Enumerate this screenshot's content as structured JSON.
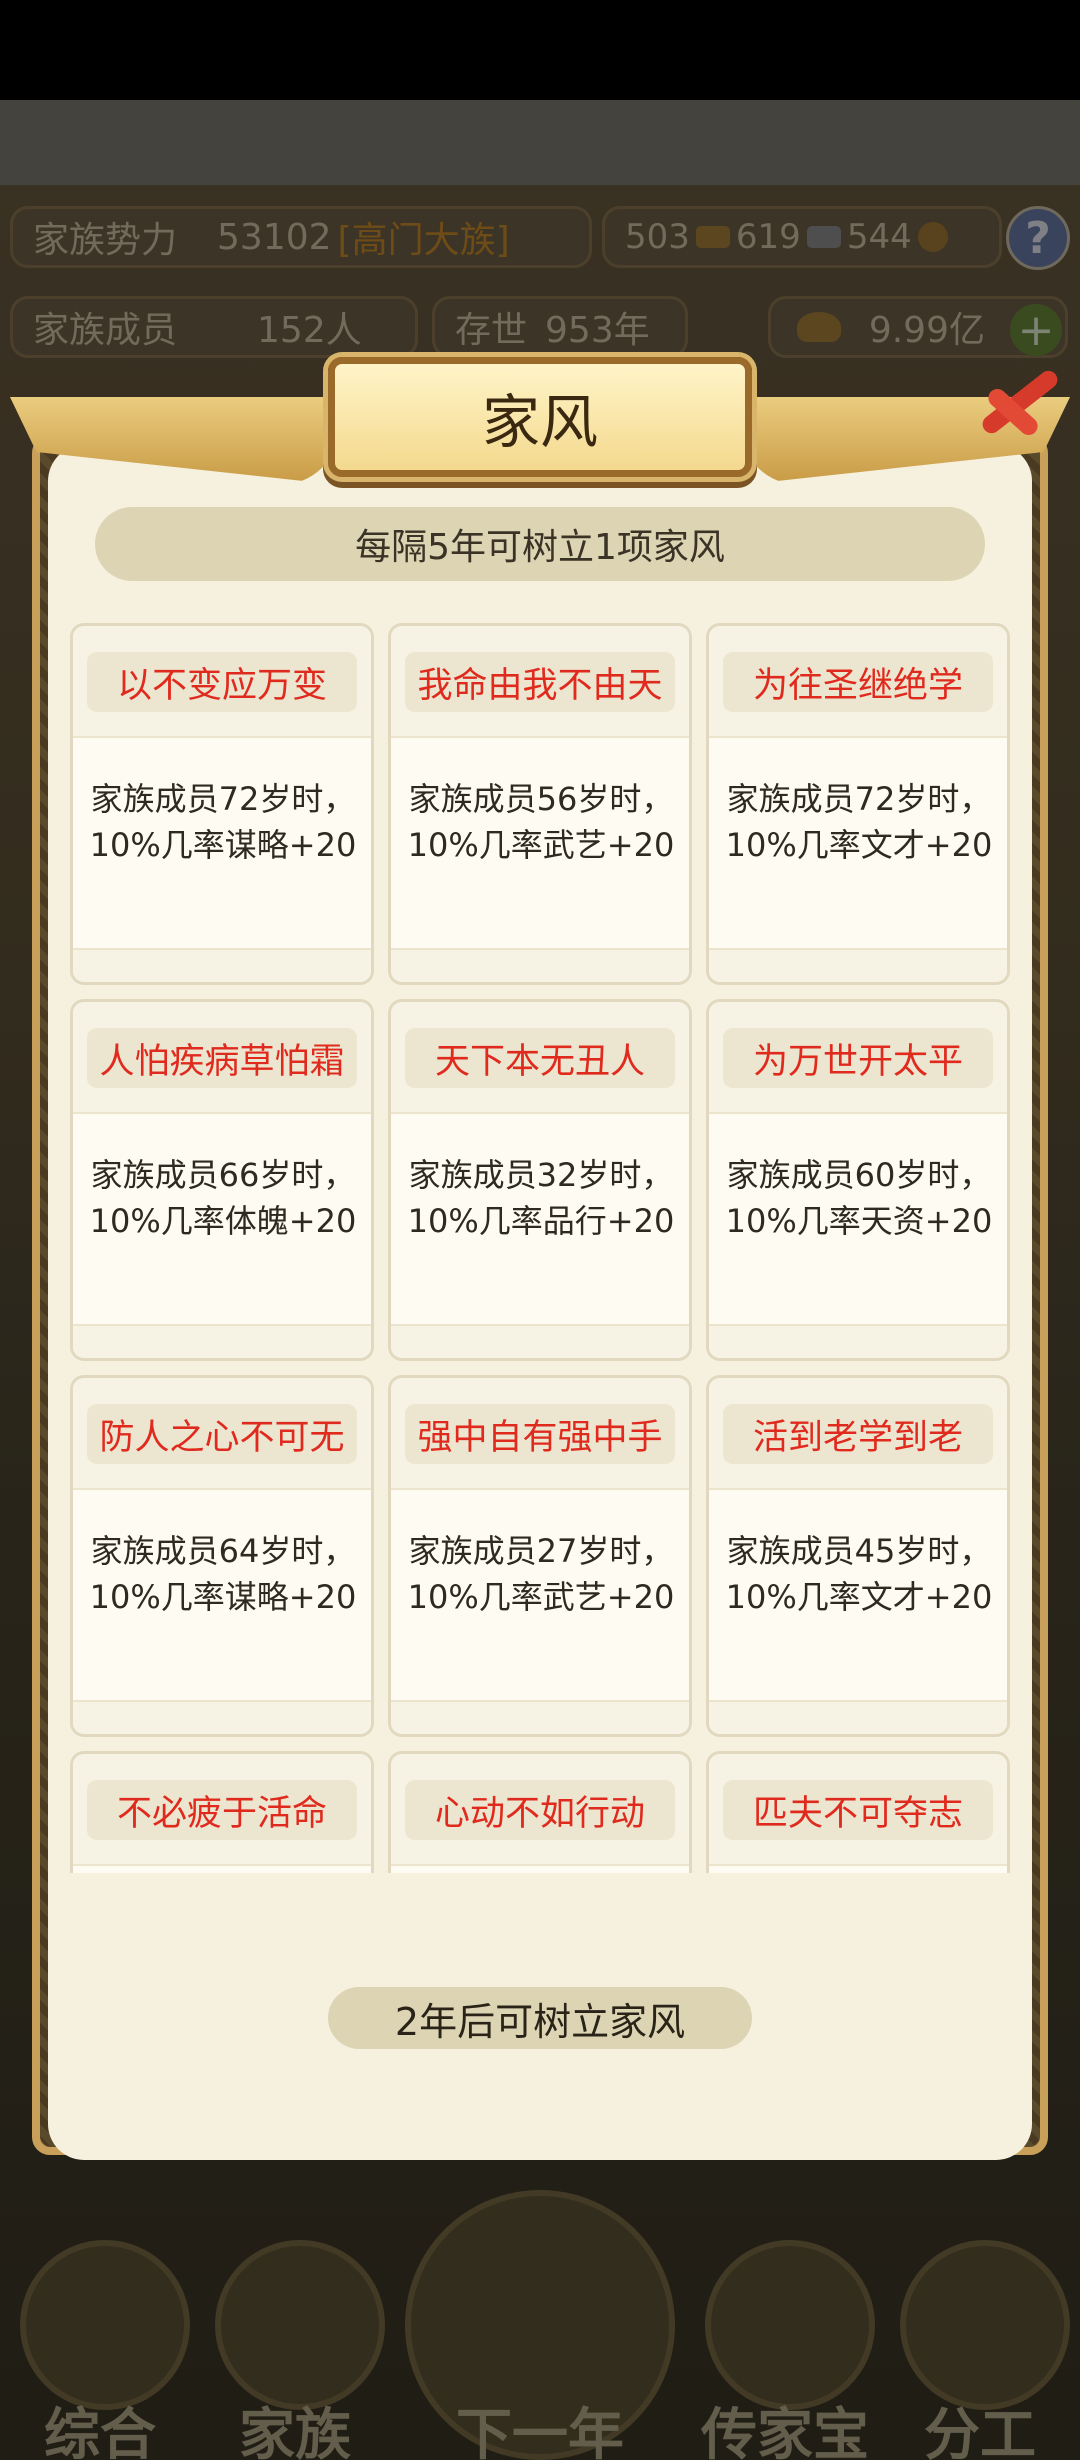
{
  "background": {
    "stats": {
      "clan_power_label": "家族势力",
      "clan_power_value": "53102",
      "clan_rank": "[高门大族]",
      "res_gold": "503",
      "res_wood": "619",
      "res_silver": "544",
      "members_label": "家族成员",
      "members_value": "152人",
      "existence_label": "存世",
      "existence_value": "953年",
      "ingot_value": "9.99亿"
    },
    "nav": [
      "综合",
      "家族",
      "下一年",
      "传家宝",
      "分工"
    ]
  },
  "dialog": {
    "title": "家风",
    "info": "每隔5年可树立1项家风",
    "cards": [
      {
        "title": "以不变应万变",
        "desc": "家族成员72岁时，10%几率谋略+20"
      },
      {
        "title": "我命由我不由天",
        "desc": "家族成员56岁时，10%几率武艺+20"
      },
      {
        "title": "为往圣继绝学",
        "desc": "家族成员72岁时，10%几率文才+20"
      },
      {
        "title": "人怕疾病草怕霜",
        "desc": "家族成员66岁时，10%几率体魄+20"
      },
      {
        "title": "天下本无丑人",
        "desc": "家族成员32岁时，10%几率品行+20"
      },
      {
        "title": "为万世开太平",
        "desc": "家族成员60岁时，10%几率天资+20"
      },
      {
        "title": "防人之心不可无",
        "desc": "家族成员64岁时，10%几率谋略+20"
      },
      {
        "title": "强中自有强中手",
        "desc": "家族成员27岁时，10%几率武艺+20"
      },
      {
        "title": "活到老学到老",
        "desc": "家族成员45岁时，10%几率文才+20"
      },
      {
        "title": "不必疲于活命",
        "desc": ""
      },
      {
        "title": "心动不如行动",
        "desc": ""
      },
      {
        "title": "匹夫不可夺志",
        "desc": ""
      }
    ],
    "bottom_status": "2年后可树立家风"
  }
}
